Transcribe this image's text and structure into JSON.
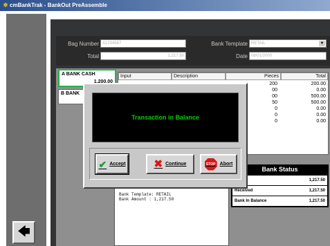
{
  "window": {
    "title": "cmBankTrak - BankOut PreAssemble",
    "icon": "app-icon"
  },
  "header": {
    "bag_number_label": "Bag Number",
    "bag_number_value": "A1234567",
    "total_label": "Total",
    "total_value": "1,217.50",
    "bank_template_label": "Bank Template",
    "bank_template_value": "RETAIL",
    "date_label": "Date",
    "date_value": "08/01/2000"
  },
  "banks": [
    {
      "label": "A BANK CASH",
      "amount": "1,200.00"
    },
    {
      "label": "B BANK",
      "amount": ""
    }
  ],
  "table": {
    "columns": [
      "Input",
      "Description",
      "Pieces",
      "Total"
    ],
    "pieces": [
      "200",
      "00",
      "00",
      "50",
      "0",
      "0",
      "0"
    ],
    "totals": [
      "200.00",
      "0.00",
      "500.00",
      "500.00",
      "0.00",
      "0.00",
      "0.00"
    ]
  },
  "status": {
    "title": "Bank Status",
    "rows": [
      {
        "label": "",
        "value": "1,217.50"
      },
      {
        "label": "Received",
        "value": "1,217.50"
      },
      {
        "label": "Bank In Balance",
        "value": "1,217.50"
      }
    ]
  },
  "receipt": {
    "line1": "Bank Template: RETAIL",
    "line2": "Bank Amount : 1,217.50"
  },
  "dialog": {
    "message": "Transaction in Balance",
    "accept_label": "Accept",
    "continue_label": "Continue",
    "abort_label": "Abort",
    "stop_icon_text": "STOP"
  },
  "nav": {
    "back_icon": "back-arrow-icon",
    "back_glyph": "🡄"
  },
  "colors": {
    "message_green": "#00d000",
    "title_blue": "#2c4f8c",
    "active_border": "#22b14c"
  }
}
